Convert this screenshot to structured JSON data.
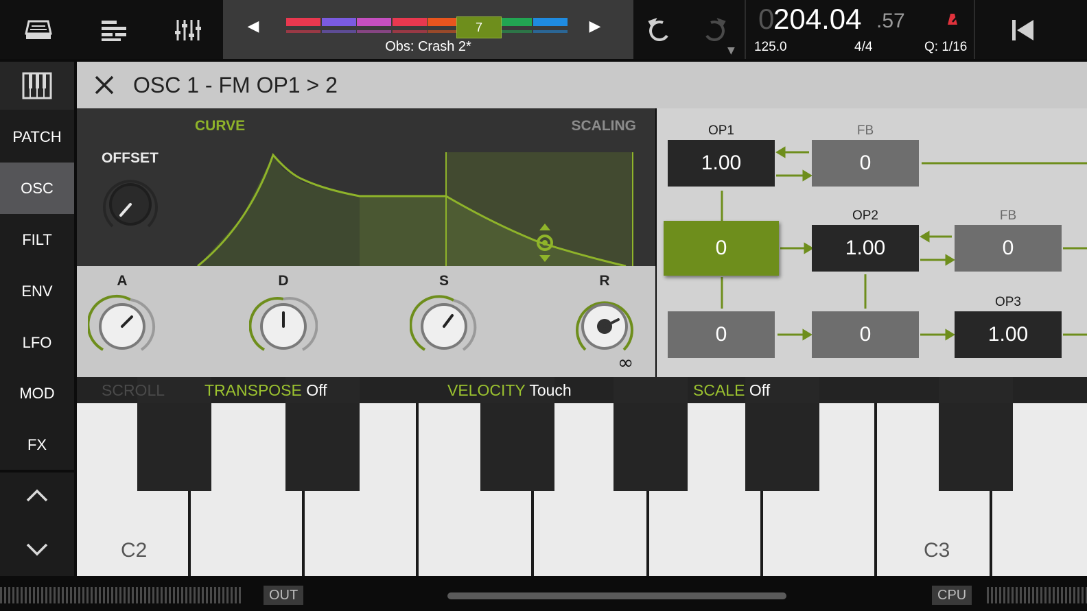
{
  "top_bar": {
    "icons": [
      "device-icon",
      "tracks-icon",
      "mixer-icon"
    ],
    "prev_arrow": "◀",
    "next_arrow": "▶",
    "pattern_number": "7",
    "song_name": "Obs: Crash 2*",
    "pattern_colors": [
      "#e8384f",
      "#7a5be0",
      "#c54fc0",
      "#e8384f",
      "#e8551e",
      "#a8c83a",
      "#22a552",
      "#1f8be0"
    ],
    "undo_icon": "undo-icon",
    "redo_icon": "redo-icon",
    "rewind_icon": "rewind-icon",
    "metronome_color": "#e0323c"
  },
  "transport": {
    "time_lead": "0",
    "time_main": "204.04",
    "time_frac": ".57",
    "tempo": "125.0",
    "signature": "4/4",
    "quantize": "Q: 1/16"
  },
  "sidebar": {
    "items": [
      {
        "label": "PATCH"
      },
      {
        "label": "OSC"
      },
      {
        "label": "FILT"
      },
      {
        "label": "ENV"
      },
      {
        "label": "LFO"
      },
      {
        "label": "MOD"
      },
      {
        "label": "FX"
      }
    ],
    "active": "OSC"
  },
  "editor": {
    "title": "OSC 1 - FM OP1 > 2",
    "tab_curve": "CURVE",
    "tab_scaling": "SCALING",
    "offset_label": "OFFSET",
    "knobs": [
      {
        "label": "A"
      },
      {
        "label": "D"
      },
      {
        "label": "S"
      },
      {
        "label": "R"
      }
    ],
    "release_infinity": "∞",
    "accent": "#8fb42a"
  },
  "fm": {
    "op1_label": "OP1",
    "op1_value": "1.00",
    "fb1_label": "FB",
    "fb1_value": "0",
    "sel_value": "0",
    "op2_label": "OP2",
    "op2_value": "1.00",
    "fb2_label": "FB",
    "fb2_value": "0",
    "bottom1_value": "0",
    "bottom2_value": "0",
    "op3_label": "OP3",
    "op3_value": "1.00"
  },
  "keyboard": {
    "scroll_label": "SCROLL",
    "transpose_label": "TRANSPOSE",
    "transpose_value": "Off",
    "velocity_label": "VELOCITY",
    "velocity_value": "Touch",
    "scale_label": "SCALE",
    "scale_value": "Off",
    "c2_label": "C2",
    "c3_label": "C3"
  },
  "status": {
    "out_label": "OUT",
    "cpu_label": "CPU"
  }
}
